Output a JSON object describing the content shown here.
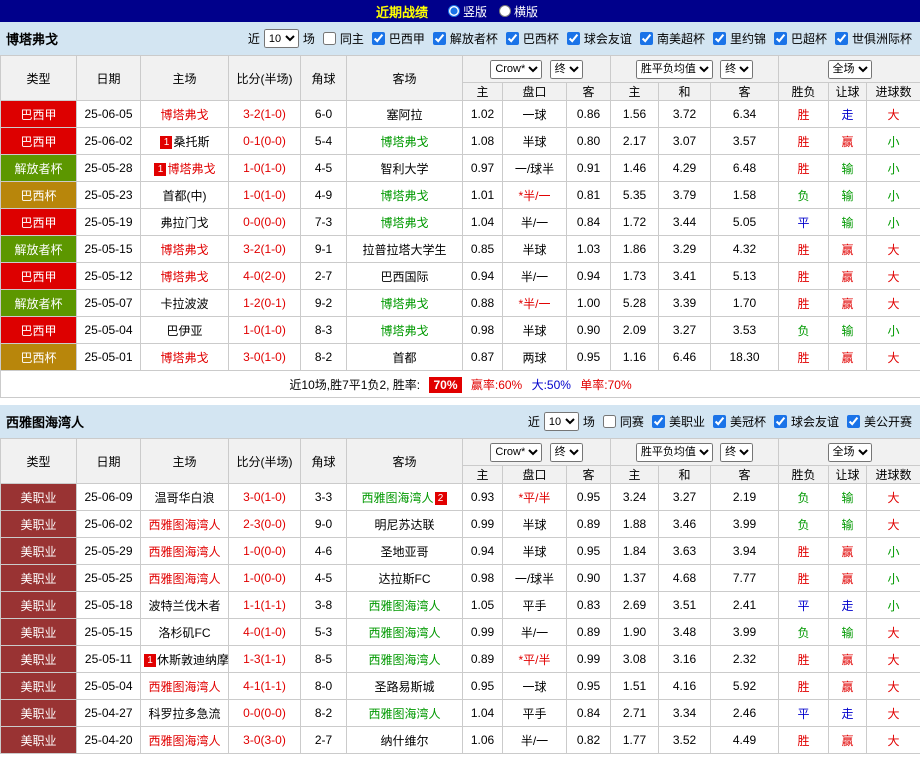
{
  "colors": {
    "red": "#E10000",
    "green": "#009900",
    "blue": "#0000CC",
    "black": "#000000",
    "topbar_bg": "#00008B",
    "title_yellow": "#FFFF00",
    "section_bg": "#D3E5F2",
    "header_bg": "#F1F1F1",
    "border": "#CBCBCB",
    "badge_bg": "#E10000",
    "league": {
      "巴西甲": "#DD0000",
      "解放者杯": "#5C9700",
      "巴西杯": "#B8860B",
      "美职业": "#993333"
    }
  },
  "topbar": {
    "title": "近期战绩",
    "options": [
      {
        "label": "竖版",
        "selected": true
      },
      {
        "label": "横版",
        "selected": false
      }
    ]
  },
  "table_header": {
    "static_cols": [
      "类型",
      "日期",
      "主场",
      "比分(半场)",
      "角球",
      "客场"
    ],
    "asia": {
      "select_a": "Crow*",
      "select_b": "终",
      "cols": [
        "主",
        "盘口",
        "客"
      ]
    },
    "europe": {
      "select_a": "胜平负均值",
      "select_b": "终",
      "cols": [
        "主",
        "和",
        "客"
      ]
    },
    "result": {
      "select_a": "全场",
      "cols": [
        "胜负",
        "让球",
        "进球数"
      ]
    }
  },
  "sections": [
    {
      "team": "博塔弗戈",
      "filter": {
        "near": "近",
        "count": "10",
        "games": "场",
        "checkboxes": [
          {
            "label": "同主",
            "checked": false
          },
          {
            "label": "巴西甲",
            "checked": true
          },
          {
            "label": "解放者杯",
            "checked": true
          },
          {
            "label": "巴西杯",
            "checked": true
          },
          {
            "label": "球会友谊",
            "checked": true
          },
          {
            "label": "南美超杯",
            "checked": true
          },
          {
            "label": "里约锦",
            "checked": true
          },
          {
            "label": "巴超杯",
            "checked": true
          },
          {
            "label": "世俱洲际杯",
            "checked": true
          }
        ]
      },
      "rows": [
        {
          "league": "巴西甲",
          "date": "25-06-05",
          "home": "博塔弗戈",
          "hc": "r",
          "hb": "",
          "score": "3-2(1-0)",
          "corner": "6-0",
          "away": "塞阿拉",
          "ac": "k",
          "ab": "",
          "ah": [
            "1.02",
            "一球",
            "0.86"
          ],
          "ahr": false,
          "eu": [
            "1.56",
            "3.72",
            "6.34"
          ],
          "res": [
            [
              "胜",
              "r"
            ],
            [
              "走",
              "b"
            ],
            [
              "大",
              "r"
            ]
          ]
        },
        {
          "league": "巴西甲",
          "date": "25-06-02",
          "home": "桑托斯",
          "hc": "k",
          "hb": "1",
          "score": "0-1(0-0)",
          "corner": "5-4",
          "away": "博塔弗戈",
          "ac": "g",
          "ab": "",
          "ah": [
            "1.08",
            "半球",
            "0.80"
          ],
          "ahr": false,
          "eu": [
            "2.17",
            "3.07",
            "3.57"
          ],
          "res": [
            [
              "胜",
              "r"
            ],
            [
              "赢",
              "r"
            ],
            [
              "小",
              "g"
            ]
          ]
        },
        {
          "league": "解放者杯",
          "date": "25-05-28",
          "home": "博塔弗戈",
          "hc": "r",
          "hb": "1",
          "score": "1-0(1-0)",
          "corner": "4-5",
          "away": "智利大学",
          "ac": "k",
          "ab": "",
          "ah": [
            "0.97",
            "一/球半",
            "0.91"
          ],
          "ahr": false,
          "eu": [
            "1.46",
            "4.29",
            "6.48"
          ],
          "res": [
            [
              "胜",
              "r"
            ],
            [
              "输",
              "g"
            ],
            [
              "小",
              "g"
            ]
          ]
        },
        {
          "league": "巴西杯",
          "date": "25-05-23",
          "home": "首都(中)",
          "hc": "k",
          "hb": "",
          "score": "1-0(1-0)",
          "corner": "4-9",
          "away": "博塔弗戈",
          "ac": "g",
          "ab": "",
          "ah": [
            "1.01",
            "*半/一",
            "0.81"
          ],
          "ahr": true,
          "eu": [
            "5.35",
            "3.79",
            "1.58"
          ],
          "res": [
            [
              "负",
              "g"
            ],
            [
              "输",
              "g"
            ],
            [
              "小",
              "g"
            ]
          ]
        },
        {
          "league": "巴西甲",
          "date": "25-05-19",
          "home": "弗拉门戈",
          "hc": "k",
          "hb": "",
          "score": "0-0(0-0)",
          "corner": "7-3",
          "away": "博塔弗戈",
          "ac": "g",
          "ab": "",
          "ah": [
            "1.04",
            "半/一",
            "0.84"
          ],
          "ahr": false,
          "eu": [
            "1.72",
            "3.44",
            "5.05"
          ],
          "res": [
            [
              "平",
              "b"
            ],
            [
              "输",
              "g"
            ],
            [
              "小",
              "g"
            ]
          ]
        },
        {
          "league": "解放者杯",
          "date": "25-05-15",
          "home": "博塔弗戈",
          "hc": "r",
          "hb": "",
          "score": "3-2(1-0)",
          "corner": "9-1",
          "away": "拉普拉塔大学生",
          "ac": "k",
          "ab": "",
          "ah": [
            "0.85",
            "半球",
            "1.03"
          ],
          "ahr": false,
          "eu": [
            "1.86",
            "3.29",
            "4.32"
          ],
          "res": [
            [
              "胜",
              "r"
            ],
            [
              "赢",
              "r"
            ],
            [
              "大",
              "r"
            ]
          ]
        },
        {
          "league": "巴西甲",
          "date": "25-05-12",
          "home": "博塔弗戈",
          "hc": "r",
          "hb": "",
          "score": "4-0(2-0)",
          "corner": "2-7",
          "away": "巴西国际",
          "ac": "k",
          "ab": "",
          "ah": [
            "0.94",
            "半/一",
            "0.94"
          ],
          "ahr": false,
          "eu": [
            "1.73",
            "3.41",
            "5.13"
          ],
          "res": [
            [
              "胜",
              "r"
            ],
            [
              "赢",
              "r"
            ],
            [
              "大",
              "r"
            ]
          ]
        },
        {
          "league": "解放者杯",
          "date": "25-05-07",
          "home": "卡拉波波",
          "hc": "k",
          "hb": "",
          "score": "1-2(0-1)",
          "corner": "9-2",
          "away": "博塔弗戈",
          "ac": "g",
          "ab": "",
          "ah": [
            "0.88",
            "*半/一",
            "1.00"
          ],
          "ahr": true,
          "eu": [
            "5.28",
            "3.39",
            "1.70"
          ],
          "res": [
            [
              "胜",
              "r"
            ],
            [
              "赢",
              "r"
            ],
            [
              "大",
              "r"
            ]
          ]
        },
        {
          "league": "巴西甲",
          "date": "25-05-04",
          "home": "巴伊亚",
          "hc": "k",
          "hb": "",
          "score": "1-0(1-0)",
          "corner": "8-3",
          "away": "博塔弗戈",
          "ac": "g",
          "ab": "",
          "ah": [
            "0.98",
            "半球",
            "0.90"
          ],
          "ahr": false,
          "eu": [
            "2.09",
            "3.27",
            "3.53"
          ],
          "res": [
            [
              "负",
              "g"
            ],
            [
              "输",
              "g"
            ],
            [
              "小",
              "g"
            ]
          ]
        },
        {
          "league": "巴西杯",
          "date": "25-05-01",
          "home": "博塔弗戈",
          "hc": "r",
          "hb": "",
          "score": "3-0(1-0)",
          "corner": "8-2",
          "away": "首都",
          "ac": "k",
          "ab": "",
          "ah": [
            "0.87",
            "两球",
            "0.95"
          ],
          "ahr": false,
          "eu": [
            "1.16",
            "6.46",
            "18.30"
          ],
          "res": [
            [
              "胜",
              "r"
            ],
            [
              "赢",
              "r"
            ],
            [
              "大",
              "r"
            ]
          ]
        }
      ],
      "summary": {
        "prefix": "近10场,胜7平1负2, 胜率:",
        "rate": "70%",
        "win_rate": "赢率:60%",
        "big_rate": "大:50%",
        "single_rate": "单率:70%"
      }
    },
    {
      "team": "西雅图海湾人",
      "filter": {
        "near": "近",
        "count": "10",
        "games": "场",
        "checkboxes": [
          {
            "label": "同赛",
            "checked": false
          },
          {
            "label": "美职业",
            "checked": true
          },
          {
            "label": "美冠杯",
            "checked": true
          },
          {
            "label": "球会友谊",
            "checked": true
          },
          {
            "label": "美公开赛",
            "checked": true
          }
        ]
      },
      "rows": [
        {
          "league": "美职业",
          "date": "25-06-09",
          "home": "温哥华白浪",
          "hc": "k",
          "hb": "",
          "score": "3-0(1-0)",
          "corner": "3-3",
          "away": "西雅图海湾人",
          "ac": "g",
          "ab": "2",
          "ah": [
            "0.93",
            "*平/半",
            "0.95"
          ],
          "ahr": true,
          "eu": [
            "3.24",
            "3.27",
            "2.19"
          ],
          "res": [
            [
              "负",
              "g"
            ],
            [
              "输",
              "g"
            ],
            [
              "大",
              "r"
            ]
          ]
        },
        {
          "league": "美职业",
          "date": "25-06-02",
          "home": "西雅图海湾人",
          "hc": "r",
          "hb": "",
          "score": "2-3(0-0)",
          "corner": "9-0",
          "away": "明尼苏达联",
          "ac": "k",
          "ab": "",
          "ah": [
            "0.99",
            "半球",
            "0.89"
          ],
          "ahr": false,
          "eu": [
            "1.88",
            "3.46",
            "3.99"
          ],
          "res": [
            [
              "负",
              "g"
            ],
            [
              "输",
              "g"
            ],
            [
              "大",
              "r"
            ]
          ]
        },
        {
          "league": "美职业",
          "date": "25-05-29",
          "home": "西雅图海湾人",
          "hc": "r",
          "hb": "",
          "score": "1-0(0-0)",
          "corner": "4-6",
          "away": "圣地亚哥",
          "ac": "k",
          "ab": "",
          "ah": [
            "0.94",
            "半球",
            "0.95"
          ],
          "ahr": false,
          "eu": [
            "1.84",
            "3.63",
            "3.94"
          ],
          "res": [
            [
              "胜",
              "r"
            ],
            [
              "赢",
              "r"
            ],
            [
              "小",
              "g"
            ]
          ]
        },
        {
          "league": "美职业",
          "date": "25-05-25",
          "home": "西雅图海湾人",
          "hc": "r",
          "hb": "",
          "score": "1-0(0-0)",
          "corner": "4-5",
          "away": "达拉斯FC",
          "ac": "k",
          "ab": "",
          "ah": [
            "0.98",
            "一/球半",
            "0.90"
          ],
          "ahr": false,
          "eu": [
            "1.37",
            "4.68",
            "7.77"
          ],
          "res": [
            [
              "胜",
              "r"
            ],
            [
              "赢",
              "r"
            ],
            [
              "小",
              "g"
            ]
          ]
        },
        {
          "league": "美职业",
          "date": "25-05-18",
          "home": "波特兰伐木者",
          "hc": "k",
          "hb": "",
          "score": "1-1(1-1)",
          "corner": "3-8",
          "away": "西雅图海湾人",
          "ac": "g",
          "ab": "",
          "ah": [
            "1.05",
            "平手",
            "0.83"
          ],
          "ahr": false,
          "eu": [
            "2.69",
            "3.51",
            "2.41"
          ],
          "res": [
            [
              "平",
              "b"
            ],
            [
              "走",
              "b"
            ],
            [
              "小",
              "g"
            ]
          ]
        },
        {
          "league": "美职业",
          "date": "25-05-15",
          "home": "洛杉矶FC",
          "hc": "k",
          "hb": "",
          "score": "4-0(1-0)",
          "corner": "5-3",
          "away": "西雅图海湾人",
          "ac": "g",
          "ab": "",
          "ah": [
            "0.99",
            "半/一",
            "0.89"
          ],
          "ahr": false,
          "eu": [
            "1.90",
            "3.48",
            "3.99"
          ],
          "res": [
            [
              "负",
              "g"
            ],
            [
              "输",
              "g"
            ],
            [
              "大",
              "r"
            ]
          ]
        },
        {
          "league": "美职业",
          "date": "25-05-11",
          "home": "休斯敦迪纳摩",
          "hc": "k",
          "hb": "1",
          "score": "1-3(1-1)",
          "corner": "8-5",
          "away": "西雅图海湾人",
          "ac": "g",
          "ab": "",
          "ah": [
            "0.89",
            "*平/半",
            "0.99"
          ],
          "ahr": true,
          "eu": [
            "3.08",
            "3.16",
            "2.32"
          ],
          "res": [
            [
              "胜",
              "r"
            ],
            [
              "赢",
              "r"
            ],
            [
              "大",
              "r"
            ]
          ]
        },
        {
          "league": "美职业",
          "date": "25-05-04",
          "home": "西雅图海湾人",
          "hc": "r",
          "hb": "",
          "score": "4-1(1-1)",
          "corner": "8-0",
          "away": "圣路易斯城",
          "ac": "k",
          "ab": "",
          "ah": [
            "0.95",
            "一球",
            "0.95"
          ],
          "ahr": false,
          "eu": [
            "1.51",
            "4.16",
            "5.92"
          ],
          "res": [
            [
              "胜",
              "r"
            ],
            [
              "赢",
              "r"
            ],
            [
              "大",
              "r"
            ]
          ]
        },
        {
          "league": "美职业",
          "date": "25-04-27",
          "home": "科罗拉多急流",
          "hc": "k",
          "hb": "",
          "score": "0-0(0-0)",
          "corner": "8-2",
          "away": "西雅图海湾人",
          "ac": "g",
          "ab": "",
          "ah": [
            "1.04",
            "平手",
            "0.84"
          ],
          "ahr": false,
          "eu": [
            "2.71",
            "3.34",
            "2.46"
          ],
          "res": [
            [
              "平",
              "b"
            ],
            [
              "走",
              "b"
            ],
            [
              "大",
              "r"
            ]
          ]
        },
        {
          "league": "美职业",
          "date": "25-04-20",
          "home": "西雅图海湾人",
          "hc": "r",
          "hb": "",
          "score": "3-0(3-0)",
          "corner": "2-7",
          "away": "纳什维尔",
          "ac": "k",
          "ab": "",
          "ah": [
            "1.06",
            "半/一",
            "0.82"
          ],
          "ahr": false,
          "eu": [
            "1.77",
            "3.52",
            "4.49"
          ],
          "res": [
            [
              "胜",
              "r"
            ],
            [
              "赢",
              "r"
            ],
            [
              "大",
              "r"
            ]
          ]
        }
      ]
    }
  ]
}
